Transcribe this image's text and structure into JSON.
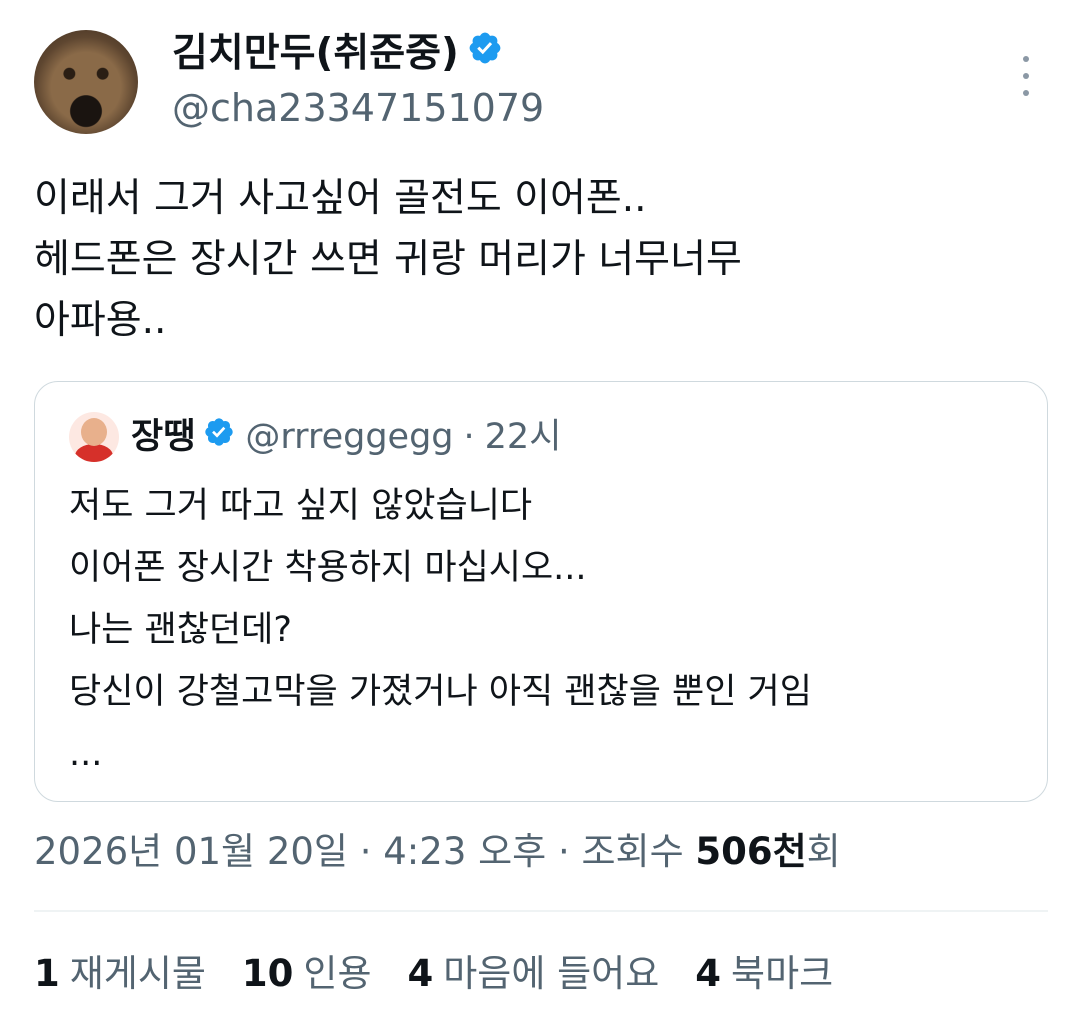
{
  "author": {
    "display_name": "김치만두(취준중)",
    "handle": "@cha23347151079",
    "verified": true
  },
  "tweet": {
    "lines": [
      "이래서 그거 사고싶어 골전도 이어폰..",
      "헤드폰은 장시간 쓰면 귀랑 머리가 너무너무",
      "아파용.."
    ]
  },
  "quote": {
    "display_name": "장땡",
    "handle": "@rrreggegg",
    "separator": "·",
    "time": "22시",
    "lines": [
      "저도 그거 따고 싶지 않았습니다",
      "이어폰 장시간 착용하지 마십시오...",
      "나는 괜찮던데?",
      "당신이 강철고막을 가졌거나 아직 괜찮을 뿐인 거임",
      "..."
    ]
  },
  "meta": {
    "date": "2026년 01월 20일",
    "sep1": "·",
    "time": "4:23 오후",
    "sep2": "·",
    "views_label": "조회수",
    "views_value": "506천",
    "views_suffix": "회"
  },
  "stats": [
    {
      "count": "1",
      "label": "재게시물"
    },
    {
      "count": "10",
      "label": "인용"
    },
    {
      "count": "4",
      "label": "마음에 들어요"
    },
    {
      "count": "4",
      "label": "북마크"
    }
  ],
  "colors": {
    "verified": "#1d9bf0",
    "secondary_text": "#536471",
    "border": "#cfd9de"
  },
  "icons": [
    "avatar",
    "verified-badge-icon",
    "more-options-icon"
  ]
}
